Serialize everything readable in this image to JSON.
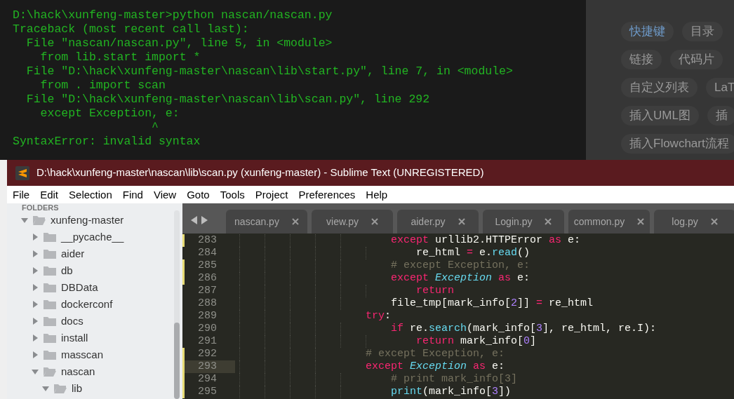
{
  "terminal": {
    "lines": [
      "D:\\hack\\xunfeng-master>python nascan/nascan.py",
      "Traceback (most recent call last):",
      "  File \"nascan/nascan.py\", line 5, in <module>",
      "    from lib.start import *",
      "  File \"D:\\hack\\xunfeng-master\\nascan\\lib\\start.py\", line 7, in <module>",
      "    from . import scan",
      "  File \"D:\\hack\\xunfeng-master\\nascan\\lib\\scan.py\", line 292",
      "    except Exception, e:",
      "                    ^",
      "SyntaxError: invalid syntax"
    ]
  },
  "side_panel": {
    "chip_rows": [
      [
        {
          "label": "快捷键",
          "selected": true
        },
        {
          "label": "目录",
          "selected": false
        }
      ],
      [
        {
          "label": "链接",
          "selected": false
        },
        {
          "label": "代码片",
          "selected": false
        }
      ],
      [
        {
          "label": "自定义列表",
          "selected": false
        },
        {
          "label": "LaT",
          "selected": false
        }
      ],
      [
        {
          "label": "插入UML图",
          "selected": false
        },
        {
          "label": "插",
          "selected": false
        }
      ],
      [
        {
          "label": "插入Flowchart流程",
          "selected": false
        }
      ]
    ]
  },
  "editor_window": {
    "title": "D:\\hack\\xunfeng-master\\nascan\\lib\\scan.py (xunfeng-master) - Sublime Text (UNREGISTERED)",
    "menu": [
      "File",
      "Edit",
      "Selection",
      "Find",
      "View",
      "Goto",
      "Tools",
      "Project",
      "Preferences",
      "Help"
    ],
    "sidebar": {
      "header": "FOLDERS",
      "tree": [
        {
          "name": "xunfeng-master",
          "expanded": true,
          "children": [
            {
              "name": "__pycache__",
              "expanded": false
            },
            {
              "name": "aider",
              "expanded": false
            },
            {
              "name": "db",
              "expanded": false
            },
            {
              "name": "DBData",
              "expanded": false
            },
            {
              "name": "dockerconf",
              "expanded": false
            },
            {
              "name": "docs",
              "expanded": false
            },
            {
              "name": "install",
              "expanded": false
            },
            {
              "name": "masscan",
              "expanded": false
            },
            {
              "name": "nascan",
              "expanded": true,
              "children": [
                {
                  "name": "lib",
                  "expanded": true
                }
              ]
            }
          ]
        }
      ]
    },
    "tabs": [
      "nascan.py",
      "view.py",
      "aider.py",
      "Login.py",
      "common.py",
      "log.py"
    ],
    "code": [
      {
        "children": [
          {
            "number": "283",
            "modified": true,
            "current": false,
            "tokens": [
              {
                "kind": "keyword",
                "text": "except"
              },
              {
                "kind": "plain",
                "text": " urllib2.HTTPError "
              },
              {
                "kind": "keyword",
                "text": "as"
              },
              {
                "kind": "plain",
                "text": " e:"
              }
            ],
            "children": [
              {
                "number": "284",
                "modified": false,
                "current": false,
                "tokens": [
                  {
                    "kind": "plain",
                    "text": "re_html "
                  },
                  {
                    "kind": "keyword",
                    "text": "="
                  },
                  {
                    "kind": "plain",
                    "text": " e."
                  },
                  {
                    "kind": "function",
                    "text": "read"
                  },
                  {
                    "kind": "plain",
                    "text": "()"
                  }
                ]
              }
            ]
          },
          {
            "number": "285",
            "modified": true,
            "current": false,
            "tokens": [
              {
                "kind": "comment",
                "text": "# except Exception, e:"
              }
            ]
          },
          {
            "number": "286",
            "modified": true,
            "current": false,
            "tokens": [
              {
                "kind": "keyword",
                "text": "except"
              },
              {
                "kind": "type",
                "text": " Exception"
              },
              {
                "kind": "keyword",
                "text": " as"
              },
              {
                "kind": "plain",
                "text": " e:"
              }
            ],
            "children": [
              {
                "number": "287",
                "modified": false,
                "current": false,
                "tokens": [
                  {
                    "kind": "keyword",
                    "text": "return"
                  }
                ]
              }
            ]
          },
          {
            "number": "288",
            "modified": false,
            "current": false,
            "tokens": [
              {
                "kind": "plain",
                "text": "file_tmp[mark_info["
              },
              {
                "kind": "number",
                "text": "2"
              },
              {
                "kind": "plain",
                "text": "]] "
              },
              {
                "kind": "keyword",
                "text": "="
              },
              {
                "kind": "plain",
                "text": " re_html"
              }
            ]
          }
        ]
      },
      {
        "number": "289",
        "modified": false,
        "current": false,
        "tokens": [
          {
            "kind": "keyword",
            "text": "try"
          },
          {
            "kind": "plain",
            "text": ":"
          }
        ],
        "children": [
          {
            "number": "290",
            "modified": false,
            "current": false,
            "tokens": [
              {
                "kind": "keyword",
                "text": "if"
              },
              {
                "kind": "plain",
                "text": " re."
              },
              {
                "kind": "function",
                "text": "search"
              },
              {
                "kind": "plain",
                "text": "(mark_info["
              },
              {
                "kind": "number",
                "text": "3"
              },
              {
                "kind": "plain",
                "text": "], re_html, re.I):"
              }
            ],
            "children": [
              {
                "number": "291",
                "modified": false,
                "current": false,
                "tokens": [
                  {
                    "kind": "keyword",
                    "text": "return"
                  },
                  {
                    "kind": "plain",
                    "text": " mark_info["
                  },
                  {
                    "kind": "number",
                    "text": "0"
                  },
                  {
                    "kind": "plain",
                    "text": "]"
                  }
                ]
              }
            ]
          }
        ]
      },
      {
        "number": "292",
        "modified": true,
        "current": false,
        "tokens": [
          {
            "kind": "comment",
            "text": "# except Exception, e:"
          }
        ]
      },
      {
        "number": "293",
        "modified": true,
        "current": true,
        "tokens": [
          {
            "kind": "keyword",
            "text": "except"
          },
          {
            "kind": "type",
            "text": " Exception"
          },
          {
            "kind": "keyword",
            "text": " as"
          },
          {
            "kind": "plain",
            "text": " e:"
          }
        ],
        "children": [
          {
            "number": "294",
            "modified": true,
            "current": false,
            "tokens": [
              {
                "kind": "comment",
                "text": "# print mark_info[3]"
              }
            ]
          },
          {
            "number": "295",
            "modified": true,
            "current": false,
            "tokens": [
              {
                "kind": "function",
                "text": "print"
              },
              {
                "kind": "plain",
                "text": "(mark_info["
              },
              {
                "kind": "number",
                "text": "3"
              },
              {
                "kind": "plain",
                "text": "])"
              }
            ]
          }
        ]
      }
    ]
  }
}
